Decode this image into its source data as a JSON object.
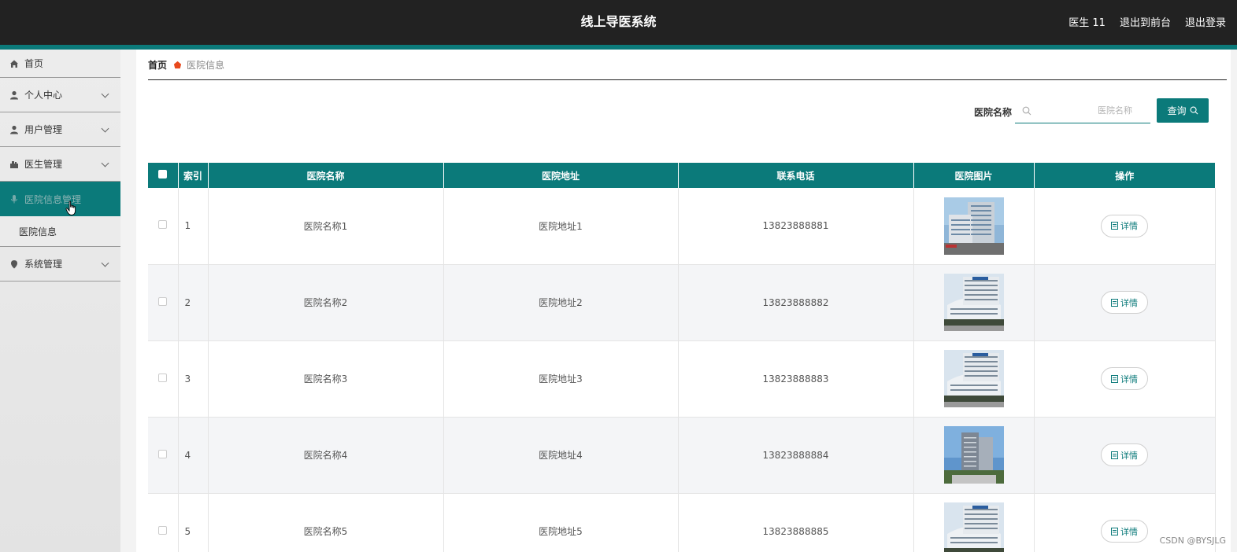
{
  "header": {
    "title": "线上导医系统",
    "user_label": "医生 11",
    "front_link": "退出到前台",
    "logout_link": "退出登录"
  },
  "sidebar": {
    "items": [
      {
        "label": "首页",
        "icon": "home-icon"
      },
      {
        "label": "个人中心",
        "icon": "user-icon"
      },
      {
        "label": "用户管理",
        "icon": "user-icon"
      },
      {
        "label": "医生管理",
        "icon": "doctor-icon"
      },
      {
        "label": "医院信息管理",
        "icon": "mic-icon",
        "active": true
      },
      {
        "label": "系统管理",
        "icon": "location-icon"
      }
    ],
    "submenu": {
      "label": "医院信息"
    }
  },
  "breadcrumb": {
    "home": "首页",
    "current": "医院信息"
  },
  "search": {
    "label": "医院名称",
    "placeholder": "医院名称",
    "button": "查询"
  },
  "table": {
    "headers": [
      "索引",
      "医院名称",
      "医院地址",
      "联系电话",
      "医院图片",
      "操作"
    ],
    "detail_label": "详情",
    "rows": [
      {
        "index": "1",
        "name": "医院名称1",
        "address": "医院地址1",
        "phone": "13823888881"
      },
      {
        "index": "2",
        "name": "医院名称2",
        "address": "医院地址2",
        "phone": "13823888882"
      },
      {
        "index": "3",
        "name": "医院名称3",
        "address": "医院地址3",
        "phone": "13823888883"
      },
      {
        "index": "4",
        "name": "医院名称4",
        "address": "医院地址4",
        "phone": "13823888884"
      },
      {
        "index": "5",
        "name": "医院名称5",
        "address": "医院地址5",
        "phone": "13823888885"
      }
    ]
  },
  "watermark": "CSDN @BYSJLG",
  "colors": {
    "accent": "#0b7a7a",
    "topbar": "#222222"
  }
}
